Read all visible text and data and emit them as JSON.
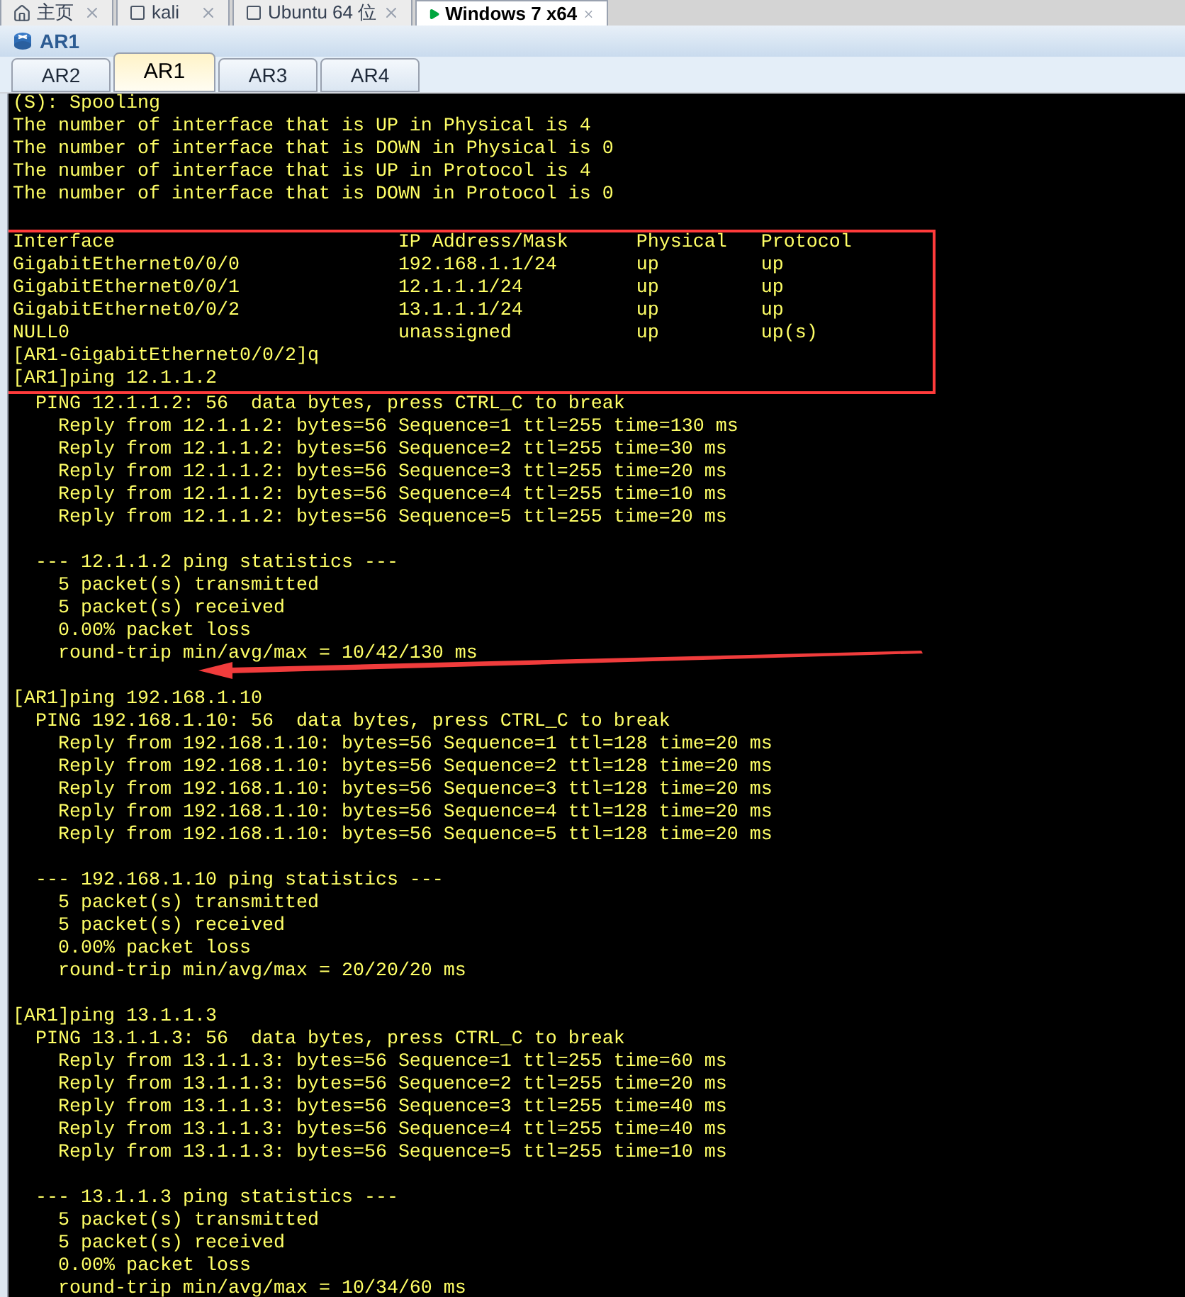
{
  "vm_tabs": [
    {
      "label": "主页",
      "kind": "home",
      "selected": false
    },
    {
      "label": "kali",
      "kind": "vm",
      "selected": false
    },
    {
      "label": "Ubuntu 64 位",
      "kind": "vm",
      "selected": false
    },
    {
      "label": "Windows 7 x64",
      "kind": "running",
      "selected": true
    }
  ],
  "window": {
    "title": "AR1"
  },
  "tabs": [
    {
      "label": "AR2",
      "selected": false
    },
    {
      "label": "AR1",
      "selected": true
    },
    {
      "label": "AR3",
      "selected": false
    },
    {
      "label": "AR4",
      "selected": false
    }
  ],
  "terminal": {
    "segments": [
      {
        "gap_before": false,
        "highlighted": false,
        "lines": [
          "(S): Spooling",
          "The number of interface that is UP in Physical is 4",
          "The number of interface that is DOWN in Physical is 0",
          "The number of interface that is UP in Protocol is 4",
          "The number of interface that is DOWN in Protocol is 0"
        ]
      },
      {
        "gap_before": true,
        "highlighted": true,
        "lines": [
          "Interface                         IP Address/Mask      Physical   Protocol",
          "GigabitEthernet0/0/0              192.168.1.1/24       up         up",
          "GigabitEthernet0/0/1              12.1.1.1/24          up         up",
          "GigabitEthernet0/0/2              13.1.1.1/24          up         up",
          "NULL0                             unassigned           up         up(s)",
          "[AR1-GigabitEthernet0/0/2]q",
          "[AR1]ping 12.1.1.2"
        ]
      },
      {
        "gap_before": false,
        "highlighted": false,
        "lines": [
          "  PING 12.1.1.2: 56  data bytes, press CTRL_C to break",
          "    Reply from 12.1.1.2: bytes=56 Sequence=1 ttl=255 time=130 ms",
          "    Reply from 12.1.1.2: bytes=56 Sequence=2 ttl=255 time=30 ms",
          "    Reply from 12.1.1.2: bytes=56 Sequence=3 ttl=255 time=20 ms",
          "    Reply from 12.1.1.2: bytes=56 Sequence=4 ttl=255 time=10 ms",
          "    Reply from 12.1.1.2: bytes=56 Sequence=5 ttl=255 time=20 ms"
        ]
      },
      {
        "gap_before": true,
        "highlighted": false,
        "lines": [
          "  --- 12.1.1.2 ping statistics ---",
          "    5 packet(s) transmitted",
          "    5 packet(s) received",
          "    0.00% packet loss",
          "    round-trip min/avg/max = 10/42/130 ms"
        ]
      },
      {
        "gap_before": true,
        "highlighted": false,
        "lines": [
          "[AR1]ping 192.168.1.10",
          "  PING 192.168.1.10: 56  data bytes, press CTRL_C to break",
          "    Reply from 192.168.1.10: bytes=56 Sequence=1 ttl=128 time=20 ms",
          "    Reply from 192.168.1.10: bytes=56 Sequence=2 ttl=128 time=20 ms",
          "    Reply from 192.168.1.10: bytes=56 Sequence=3 ttl=128 time=20 ms",
          "    Reply from 192.168.1.10: bytes=56 Sequence=4 ttl=128 time=20 ms",
          "    Reply from 192.168.1.10: bytes=56 Sequence=5 ttl=128 time=20 ms"
        ]
      },
      {
        "gap_before": true,
        "highlighted": false,
        "lines": [
          "  --- 192.168.1.10 ping statistics ---",
          "    5 packet(s) transmitted",
          "    5 packet(s) received",
          "    0.00% packet loss",
          "    round-trip min/avg/max = 20/20/20 ms"
        ]
      },
      {
        "gap_before": true,
        "highlighted": false,
        "lines": [
          "[AR1]ping 13.1.1.3",
          "  PING 13.1.1.3: 56  data bytes, press CTRL_C to break",
          "    Reply from 13.1.1.3: bytes=56 Sequence=1 ttl=255 time=60 ms",
          "    Reply from 13.1.1.3: bytes=56 Sequence=2 ttl=255 time=20 ms",
          "    Reply from 13.1.1.3: bytes=56 Sequence=3 ttl=255 time=40 ms",
          "    Reply from 13.1.1.3: bytes=56 Sequence=4 ttl=255 time=40 ms",
          "    Reply from 13.1.1.3: bytes=56 Sequence=5 ttl=255 time=10 ms"
        ]
      },
      {
        "gap_before": true,
        "highlighted": false,
        "lines": [
          "  --- 13.1.1.3 ping statistics ---",
          "    5 packet(s) transmitted",
          "    5 packet(s) received",
          "    0.00% packet loss",
          "    round-trip min/avg/max = 10/34/60 ms"
        ]
      }
    ]
  }
}
